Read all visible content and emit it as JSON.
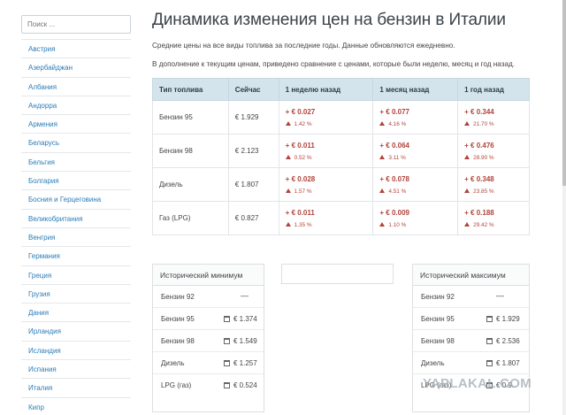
{
  "sidebar": {
    "search_placeholder": "Поиск ...",
    "countries": [
      "Австрия",
      "Азербайджан",
      "Албания",
      "Андорра",
      "Армения",
      "Беларусь",
      "Бельгия",
      "Болгария",
      "Босния и Герцеговина",
      "Великобритания",
      "Венгрия",
      "Германия",
      "Греция",
      "Грузия",
      "Дания",
      "Ирландия",
      "Исландия",
      "Испания",
      "Италия",
      "Кипр"
    ]
  },
  "main": {
    "title": "Динамика изменения цен на бензин в Италии",
    "description": "Средние цены на все виды топлива за последние годы. Данные обновляются ежедневно.",
    "description2": "В дополнение к текущим ценам, приведено сравнение с ценами, которые были неделю, месяц и год назад."
  },
  "table": {
    "headers": [
      "Тип топлива",
      "Сейчас",
      "1 неделю назад",
      "1 месяц назад",
      "1 год назад"
    ],
    "rows": [
      {
        "fuel": "Бензин 95",
        "now": "€ 1.929",
        "w_ch": "+ € 0.027",
        "w_pc": "1.42 %",
        "m_ch": "+ € 0.077",
        "m_pc": "4.16 %",
        "y_ch": "+ € 0.344",
        "y_pc": "21.70 %"
      },
      {
        "fuel": "Бензин 98",
        "now": "€ 2.123",
        "w_ch": "+ € 0.011",
        "w_pc": "0.52 %",
        "m_ch": "+ € 0.064",
        "m_pc": "3.11 %",
        "y_ch": "+ € 0.476",
        "y_pc": "28.90 %"
      },
      {
        "fuel": "Дизель",
        "now": "€ 1.807",
        "w_ch": "+ € 0.028",
        "w_pc": "1.57 %",
        "m_ch": "+ € 0.078",
        "m_pc": "4.51 %",
        "y_ch": "+ € 0.348",
        "y_pc": "23.85 %"
      },
      {
        "fuel": "Газ (LPG)",
        "now": "€ 0.827",
        "w_ch": "+ € 0.011",
        "w_pc": "1.35 %",
        "m_ch": "+ € 0.009",
        "m_pc": "1.10 %",
        "y_ch": "+ € 0.188",
        "y_pc": "29.42 %"
      }
    ]
  },
  "hist_min": {
    "title": "Исторический минимум",
    "rows": [
      {
        "label": "Бензин 92",
        "value": "—"
      },
      {
        "label": "Бензин 95",
        "value": "€ 1.374"
      },
      {
        "label": "Бензин 98",
        "value": "€ 1.549"
      },
      {
        "label": "Дизель",
        "value": "€ 1.257"
      },
      {
        "label": "LPG (газ)",
        "value": "€ 0.524"
      }
    ]
  },
  "hist_max": {
    "title": "Исторический максимум",
    "rows": [
      {
        "label": "Бензин 92",
        "value": "—"
      },
      {
        "label": "Бензин 95",
        "value": "€ 1.929"
      },
      {
        "label": "Бензин 98",
        "value": "€ 2.536"
      },
      {
        "label": "Дизель",
        "value": "€ 1.807"
      },
      {
        "label": "LPG (газ)",
        "value": "€ 0.9.."
      }
    ]
  },
  "watermark": "YAPLAKAL.COM",
  "colors": {
    "accent": "#2a7db8",
    "increase": "#b0443b",
    "table_header": "#d3e4ec"
  }
}
